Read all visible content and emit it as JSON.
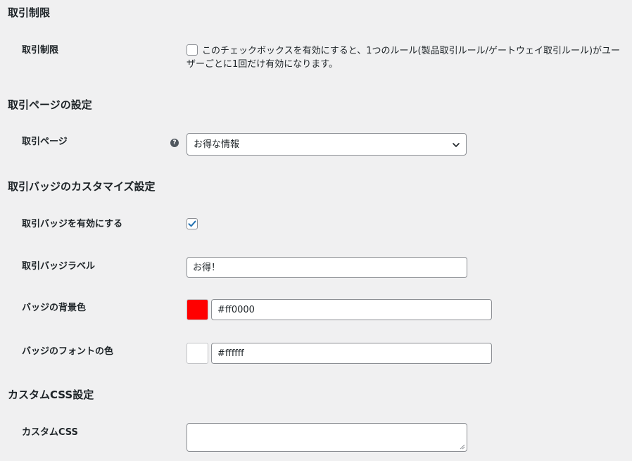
{
  "sections": {
    "restriction": {
      "title": "取引制限",
      "row_label": "取引制限",
      "checkbox_checked": false,
      "description": "このチェックボックスを有効にすると、1つのルール(製品取引ルール/ゲートウェイ取引ルール)がユーザーごとに1回だけ有効になります。"
    },
    "deal_page": {
      "title": "取引ページの設定",
      "row_label": "取引ページ",
      "help_icon": "question-circle-icon",
      "select_value": "お得な情報"
    },
    "badge": {
      "title": "取引バッジのカスタマイズ設定",
      "enable_label": "取引バッジを有効にする",
      "enable_checked": true,
      "label_row": "取引バッジラベル",
      "label_value": "お得！",
      "bg_label": "バッジの背景色",
      "bg_color": "#ff0000",
      "bg_value": "#ff0000",
      "font_label": "バッジのフォントの色",
      "font_color": "#ffffff",
      "font_value": "#ffffff"
    },
    "custom_css": {
      "title": "カスタムCSS設定",
      "row_label": "カスタムCSS",
      "value": ""
    }
  },
  "colors": {
    "background": "#f0f0f1",
    "checkbox_check": "#2271b1",
    "border": "#8c8f94"
  }
}
